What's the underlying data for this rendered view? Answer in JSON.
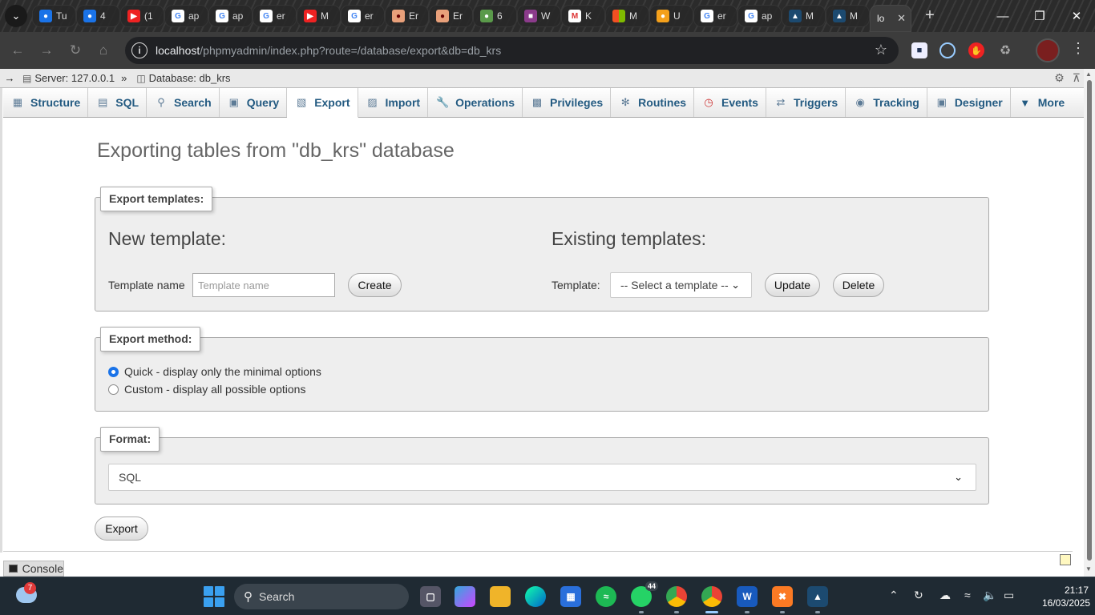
{
  "browser": {
    "tab_labels": [
      "Tu",
      "4",
      "(1",
      "ap",
      "ap",
      "er",
      "M",
      "er",
      "Er",
      "Er",
      "6",
      "W",
      "K",
      "M",
      "U",
      "er",
      "ap",
      "M",
      "M"
    ],
    "active_tab_label": "lo",
    "url_host": "localhost",
    "url_path": "/phpmyadmin/index.php?route=/database/export&db=db_krs"
  },
  "breadcrumb": {
    "server": "Server: 127.0.0.1",
    "separator": "»",
    "database": "Database: db_krs"
  },
  "topmenu": [
    "Structure",
    "SQL",
    "Search",
    "Query",
    "Export",
    "Import",
    "Operations",
    "Privileges",
    "Routines",
    "Events",
    "Triggers",
    "Tracking",
    "Designer",
    "More"
  ],
  "page": {
    "title": "Exporting tables from \"db_krs\" database"
  },
  "export_templates": {
    "legend": "Export templates:",
    "new_heading": "New template:",
    "name_label": "Template name",
    "name_placeholder": "Template name",
    "create_label": "Create",
    "existing_heading": "Existing templates:",
    "template_label": "Template:",
    "template_select": "-- Select a template --",
    "update_label": "Update",
    "delete_label": "Delete"
  },
  "export_method": {
    "legend": "Export method:",
    "options": [
      "Quick - display only the minimal options",
      "Custom - display all possible options"
    ],
    "selected": 0
  },
  "format": {
    "legend": "Format:",
    "value": "SQL"
  },
  "export_button": "Export",
  "console_label": "Console",
  "taskbar": {
    "weather_badge": "7",
    "search_label": "Search",
    "whatsapp_badge": "44",
    "time": "21:17",
    "date": "16/03/2025"
  }
}
